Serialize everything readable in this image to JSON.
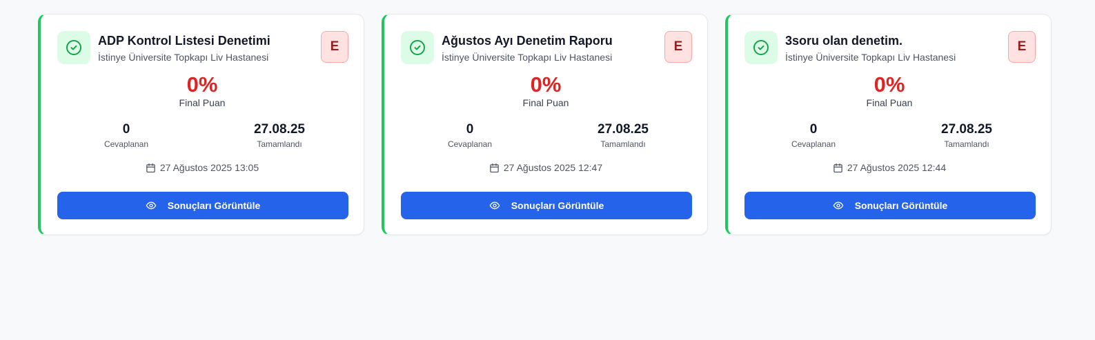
{
  "cards": [
    {
      "title": "ADP Kontrol Listesi Denetimi",
      "hospital": "İstinye Üniversite Topkapı Liv Hastanesi",
      "grade": "E",
      "score": "0%",
      "score_label": "Final Puan",
      "answered_value": "0",
      "answered_label": "Cevaplanan",
      "completed_value": "27.08.25",
      "completed_label": "Tamamlandı",
      "datetime": "27 Ağustos 2025 13:05",
      "button_label": "Sonuçları Görüntüle"
    },
    {
      "title": "Ağustos Ayı Denetim Raporu",
      "hospital": "İstinye Üniversite Topkapı Liv Hastanesi",
      "grade": "E",
      "score": "0%",
      "score_label": "Final Puan",
      "answered_value": "0",
      "answered_label": "Cevaplanan",
      "completed_value": "27.08.25",
      "completed_label": "Tamamlandı",
      "datetime": "27 Ağustos 2025 12:47",
      "button_label": "Sonuçları Görüntüle"
    },
    {
      "title": "3soru olan denetim.",
      "hospital": "İstinye Üniversite Topkapı Liv Hastanesi",
      "grade": "E",
      "score": "0%",
      "score_label": "Final Puan",
      "answered_value": "0",
      "answered_label": "Cevaplanan",
      "completed_value": "27.08.25",
      "completed_label": "Tamamlandı",
      "datetime": "27 Ağustos 2025 12:44",
      "button_label": "Sonuçları Görüntüle"
    }
  ],
  "colors": {
    "accent_green": "#22c55e",
    "score_red": "#dc2626",
    "grade_bg": "#fee2e2",
    "button_blue": "#2563eb"
  },
  "icons": {
    "status": "check-circle-icon",
    "date": "calendar-icon",
    "button": "eye-icon"
  }
}
